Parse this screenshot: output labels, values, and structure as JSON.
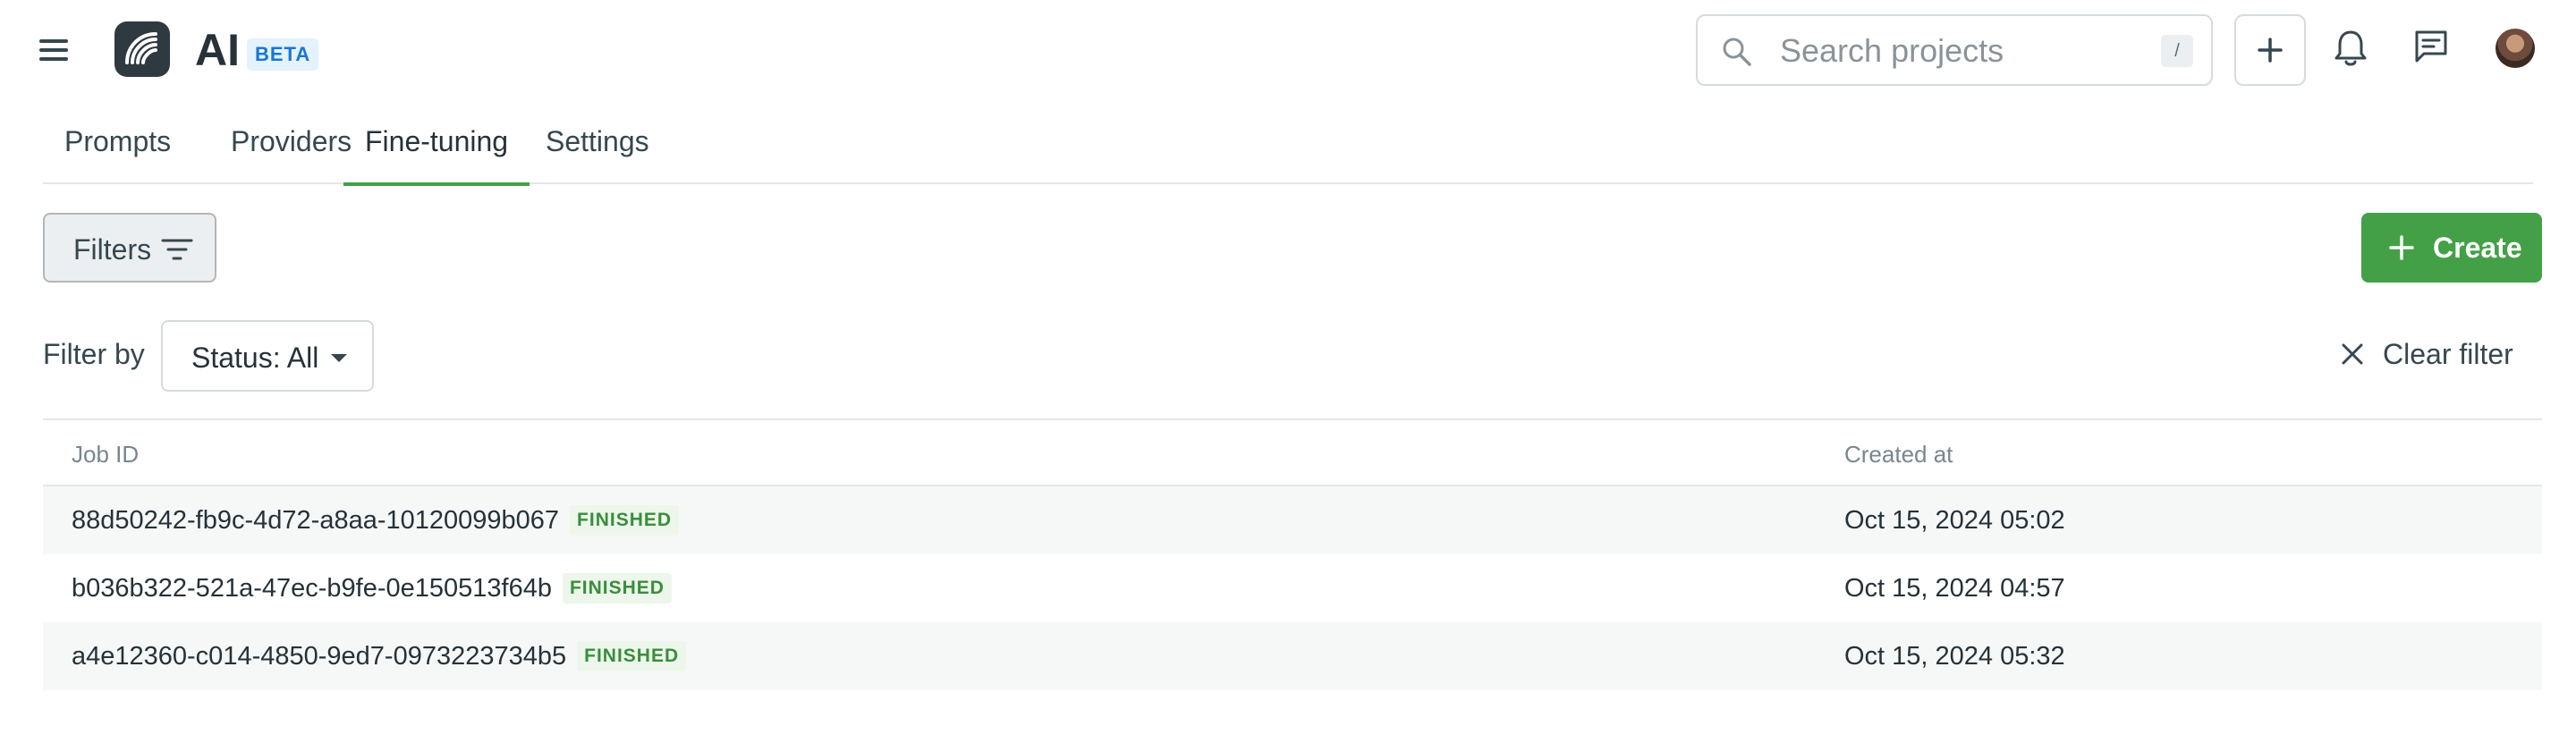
{
  "header": {
    "app_title": "AI",
    "beta_badge": "BETA",
    "search": {
      "placeholder": "Search projects",
      "value": "",
      "shortcut": "/"
    },
    "icons": [
      "menu-icon",
      "logo-icon",
      "search-icon",
      "plus-icon",
      "bell-icon",
      "chat-icon",
      "avatar"
    ]
  },
  "tabs": [
    {
      "label": "Prompts",
      "active": false
    },
    {
      "label": "Providers",
      "active": false
    },
    {
      "label": "Fine-tuning",
      "active": true
    },
    {
      "label": "Settings",
      "active": false
    }
  ],
  "toolbar": {
    "filters_label": "Filters",
    "create_label": "Create",
    "filter_by_label": "Filter by",
    "status_filter_value": "Status: All",
    "clear_filter_label": "Clear filter"
  },
  "table": {
    "columns": [
      "Job ID",
      "Created at"
    ],
    "rows": [
      {
        "job_id": "88d50242-fb9c-4d72-a8aa-10120099b067",
        "status": "FINISHED",
        "created_at": "Oct 15, 2024 05:02"
      },
      {
        "job_id": "b036b322-521a-47ec-b9fe-0e150513f64b",
        "status": "FINISHED",
        "created_at": "Oct 15, 2024 04:57"
      },
      {
        "job_id": "a4e12360-c014-4850-9ed7-0973223734b5",
        "status": "FINISHED",
        "created_at": "Oct 15, 2024 05:32"
      }
    ]
  },
  "colors": {
    "accent_green": "#43a047",
    "badge_green_text": "#388e3c",
    "badge_green_bg": "#edf6ea",
    "beta_blue": "#1976d2",
    "text_dark": "#263238"
  }
}
